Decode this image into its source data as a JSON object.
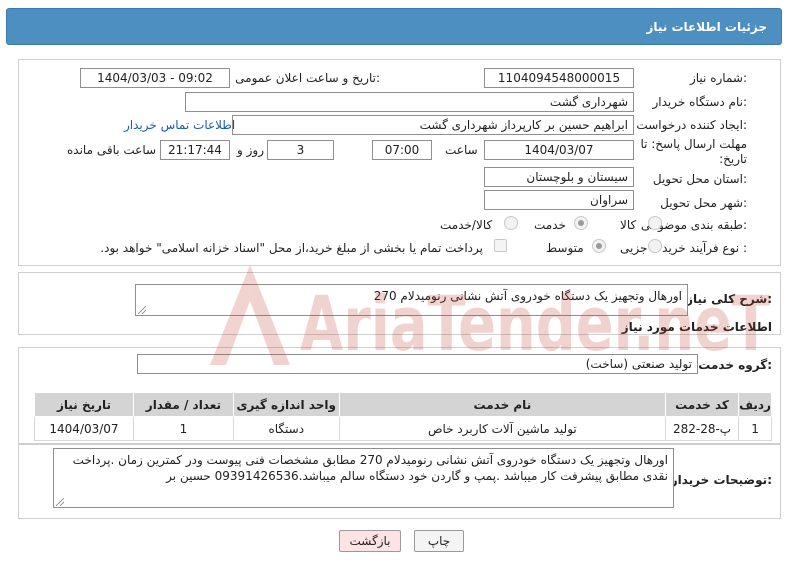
{
  "header": {
    "title": "جزئیات اطلاعات نیاز"
  },
  "fields": {
    "need_number_label": "شماره نیاز:",
    "need_number": "1104094548000015",
    "announce_label": "تاریخ و ساعت اعلان عمومی:",
    "announce_value": "1404/03/03 - 09:02",
    "buyer_org_label": "نام دستگاه خریدار:",
    "buyer_org": "شهرداری گشت",
    "creator_label": "ایجاد کننده درخواست:",
    "creator": "ابراهیم حسین بر کارپرداز شهرداری گشت",
    "contact_link": "اطلاعات تماس خریدار",
    "deadline_label": "مهلت ارسال پاسخ: تا تاریخ:",
    "deadline_date": "1404/03/07",
    "time_label": "ساعت",
    "deadline_time": "07:00",
    "days": "3",
    "days_label": "روز و",
    "remaining": "21:17:44",
    "remaining_label": "ساعت باقی مانده",
    "province_label": "استان محل تحویل:",
    "province": "سیستان و بلوچستان",
    "city_label": "شهر محل تحویل:",
    "city": "سراوان",
    "category_label": "طبقه بندی موضوعی:",
    "category_options": [
      "کالا",
      "خدمت",
      "کالا/خدمت"
    ],
    "category_selected": "خدمت",
    "process_label": "نوع فرآیند خرید :",
    "process_options": [
      "جزیی",
      "متوسط"
    ],
    "process_selected": "متوسط",
    "payment_note": "پرداخت تمام یا بخشی از مبلغ خرید،از محل \"اسناد خزانه اسلامی\" خواهد بود."
  },
  "summary": {
    "label": "شرح کلی نیاز:",
    "text": "اورهال وتجهیز یک دستگاه خودروی آتش نشانی رنومیدلام 270"
  },
  "services": {
    "section_title": "اطلاعات خدمات مورد نیاز",
    "group_label": "گروه خدمت:",
    "group_value": "تولید صنعتی (ساخت)",
    "columns": [
      "ردیف",
      "کد خدمت",
      "نام خدمت",
      "واحد اندازه گیری",
      "تعداد / مقدار",
      "تاریخ نیاز"
    ],
    "rows": [
      [
        "1",
        "پ-28-282",
        "تولید ماشین آلات کاربرد خاص",
        "دستگاه",
        "1",
        "1404/03/07"
      ]
    ]
  },
  "buyer_notes": {
    "label": "توضیحات خریدار:",
    "text": "اورهال وتجهیز یک دستگاه خودروی آتش نشانی رنومیدلام 270 مطابق مشخصات فنی پیوست ودر کمترین زمان .پرداخت نقدی مطابق پیشرفت کار میباشد .پمپ و گاردن خود دستگاه سالم میباشد.09391426536 حسین بر"
  },
  "buttons": {
    "print": "چاپ",
    "back": "بازگشت"
  },
  "watermark": {
    "text": "AriaTender.neT"
  },
  "colors": {
    "header_bg": "#4c8fc0",
    "table_head": "#d4d4d4",
    "back_button": "#fde3e3",
    "watermark": "#c0392b"
  }
}
